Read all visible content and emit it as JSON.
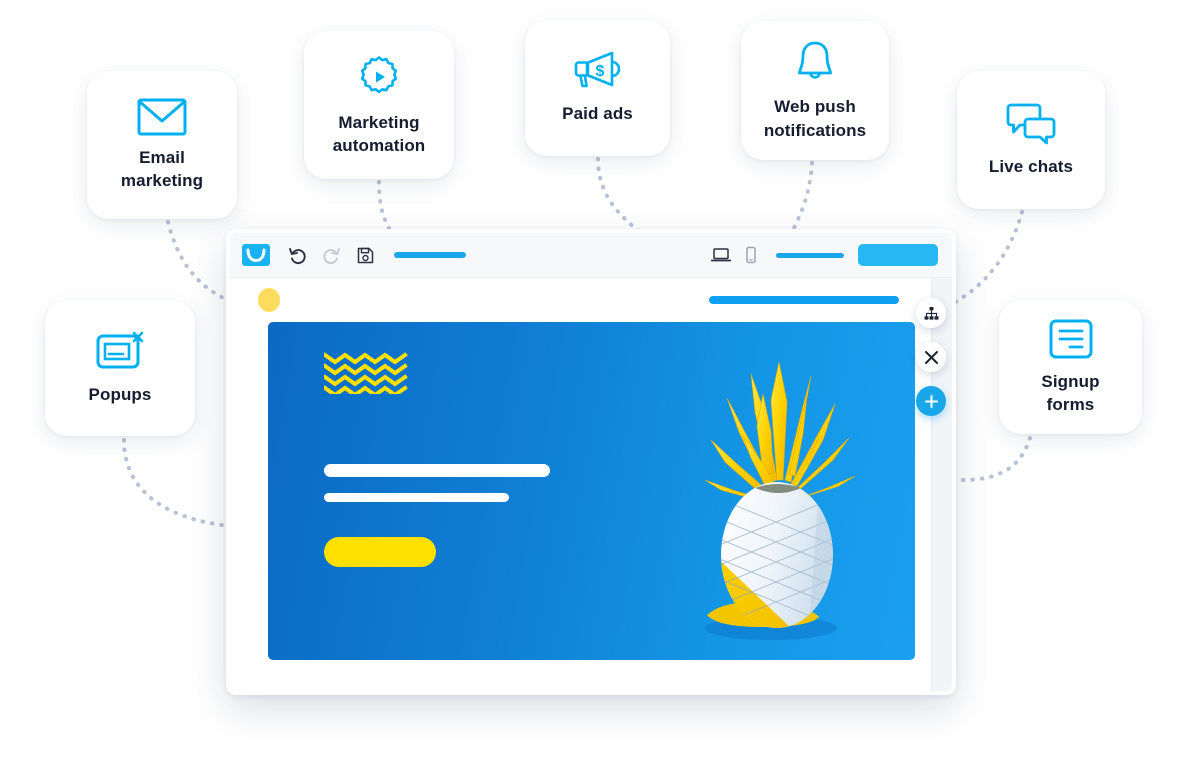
{
  "theme": {
    "accent_blue": "#1aa7ea",
    "icon_blue": "#00b0f0",
    "text_dark": "#151c30",
    "hero_blue": "#0f7fd4",
    "yellow": "#ffe000",
    "dotted_gray": "#b8c2d4",
    "page_background": "#ffffff"
  },
  "channel_cards": [
    {
      "id": "email",
      "label": "Email\nmarketing",
      "icon": "envelope-icon"
    },
    {
      "id": "automation",
      "label": "Marketing\nautomation",
      "icon": "gear-play-icon"
    },
    {
      "id": "paidads",
      "label": "Paid ads",
      "icon": "megaphone-dollar-icon"
    },
    {
      "id": "webpush",
      "label": "Web push\nnotifications",
      "icon": "bell-icon"
    },
    {
      "id": "livechats",
      "label": "Live chats",
      "icon": "chat-bubbles-icon"
    },
    {
      "id": "popups",
      "label": "Popups",
      "icon": "popup-window-icon"
    },
    {
      "id": "signupforms",
      "label": "Signup\nforms",
      "icon": "form-lines-icon"
    }
  ],
  "editor": {
    "toolbar": {
      "brand_icon": "envelope-logo-icon",
      "undo_icon": "undo-arrow-icon",
      "redo_icon": "redo-arrow-icon",
      "save_icon": "floppy-disk-icon",
      "desktop_view_icon": "laptop-icon",
      "mobile_view_icon": "smartphone-icon",
      "undo_state": "enabled",
      "redo_state": "disabled",
      "active_view": "desktop",
      "title_placeholder": "",
      "secondary_placeholder": "",
      "primary_action_label": ""
    },
    "canvas": {
      "logo_placeholder": "",
      "nav_placeholder": "",
      "hero": {
        "decoration": "yellow-zigzag-pattern",
        "zigzag_rows": 4,
        "headline_placeholder": "",
        "subline_placeholder": "",
        "cta_placeholder": "",
        "product_image": "white-painted-pineapple-on-blue"
      }
    },
    "side_actions": [
      {
        "id": "structure",
        "icon": "sitemap-icon",
        "style": "light"
      },
      {
        "id": "close",
        "icon": "close-x-icon",
        "style": "light"
      },
      {
        "id": "add",
        "icon": "plus-icon",
        "style": "accent"
      }
    ]
  },
  "connectors": {
    "style": "dotted",
    "count": 7,
    "description": "dotted curves linking each channel card to the editor window"
  }
}
